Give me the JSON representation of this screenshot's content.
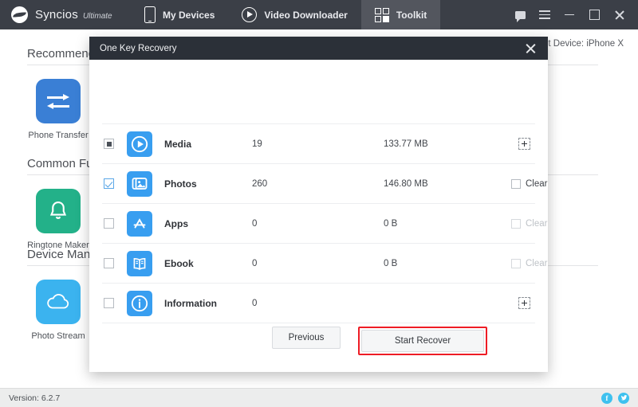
{
  "titlebar": {
    "brand_name": "Syncios",
    "brand_edition": "Ultimate",
    "nav": [
      {
        "label": "My Devices",
        "icon": "phone-icon",
        "active": false
      },
      {
        "label": "Video Downloader",
        "icon": "play-circle-icon",
        "active": false
      },
      {
        "label": "Toolkit",
        "icon": "toolkit-grid-icon",
        "active": true
      }
    ],
    "window_controls": [
      "feedback-bubble-icon",
      "menu-icon",
      "minimize-icon",
      "maximize-icon",
      "close-icon"
    ]
  },
  "page": {
    "device_label": "Current Device: iPhone X",
    "sections": [
      {
        "title": "Recommend",
        "tile_label": "Phone Transfer",
        "tile_icon": "transfer-arrows-icon",
        "tile_color": "#3a7fd5"
      },
      {
        "title": "Common Function",
        "tile_label": "Ringtone Maker",
        "tile_icon": "bell-icon",
        "tile_color": "#23b189"
      },
      {
        "title": "Device Manage",
        "tile_label": "Photo Stream",
        "tile_icon": "cloud-icon",
        "tile_color": "#3bb3ef"
      }
    ]
  },
  "dialog": {
    "title": "One Key Recovery",
    "close_icon": "close-icon",
    "columns": [
      "select",
      "type",
      "count",
      "size",
      "action"
    ],
    "rows": [
      {
        "name": "Media",
        "icon": "media-play-icon",
        "count": "19",
        "size": "133.77 MB",
        "checkbox_state": "partial",
        "action": "expand",
        "action_label": "",
        "action_disabled": false
      },
      {
        "name": "Photos",
        "icon": "photos-icon",
        "count": "260",
        "size": "146.80 MB",
        "checkbox_state": "checked",
        "action": "clear",
        "action_label": "Clear",
        "action_disabled": false
      },
      {
        "name": "Apps",
        "icon": "apps-store-icon",
        "count": "0",
        "size": "0 B",
        "checkbox_state": "unchecked",
        "action": "clear",
        "action_label": "Clear",
        "action_disabled": true
      },
      {
        "name": "Ebook",
        "icon": "book-icon",
        "count": "0",
        "size": "0 B",
        "checkbox_state": "unchecked",
        "action": "clear",
        "action_label": "Clear",
        "action_disabled": true
      },
      {
        "name": "Information",
        "icon": "info-circle-icon",
        "count": "0",
        "size": "",
        "checkbox_state": "unchecked",
        "action": "expand",
        "action_label": "",
        "action_disabled": false
      }
    ],
    "buttons": {
      "previous_label": "Previous",
      "start_label": "Start Recover",
      "highlight_color": "#ee1c25"
    }
  },
  "footer": {
    "version": "Version: 6.2.7",
    "socials": [
      {
        "name": "facebook-icon",
        "glyph": "f"
      },
      {
        "name": "twitter-icon",
        "glyph": "ᴛ"
      }
    ]
  },
  "colors": {
    "header_bg": "#3b3f47",
    "dialog_header_bg": "#2b3038",
    "accent_blue": "#389ef0",
    "footer_bg": "#eceded"
  }
}
